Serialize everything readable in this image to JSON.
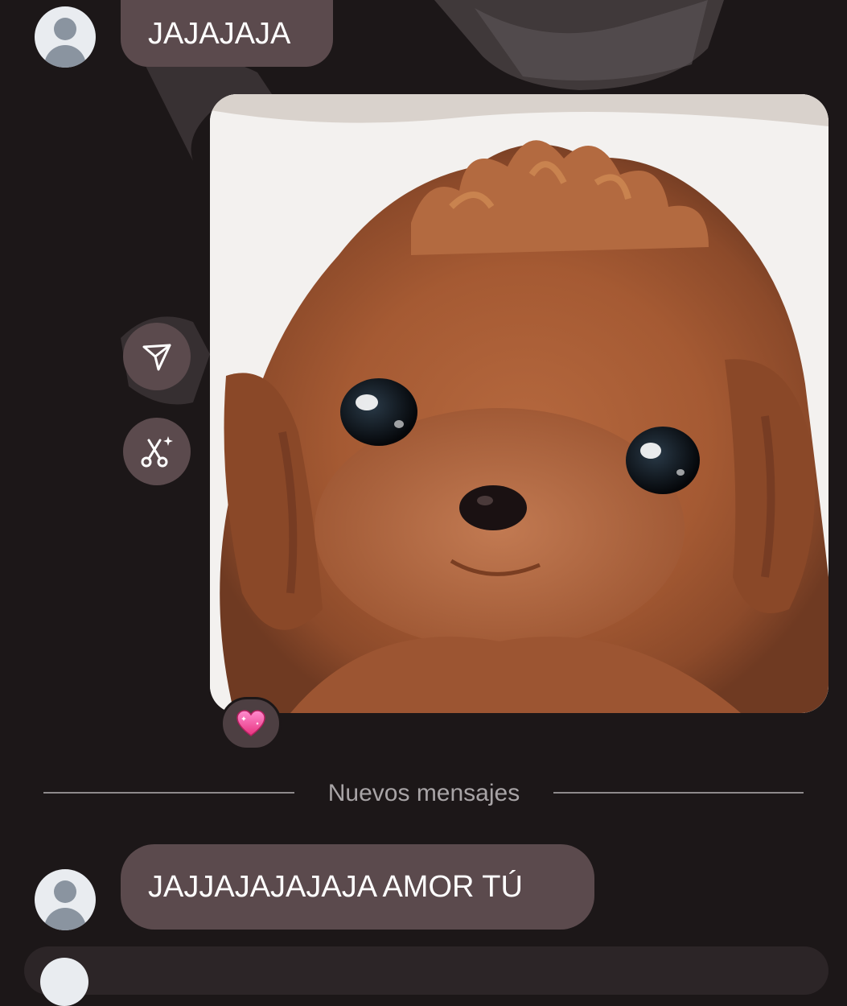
{
  "colors": {
    "background": "#1c1718",
    "bubble": "#5b4a4d",
    "divider": "#8e8a8c",
    "divider_text": "#a8a4a6"
  },
  "messages": [
    {
      "sender": "other",
      "text": "JAJAJAJA"
    },
    {
      "sender": "other",
      "type": "photo",
      "content": "puppy-photo",
      "reaction": "💗"
    },
    {
      "sender": "other",
      "text": "JAJJAJAJAJAJA AMOR TÚ"
    }
  ],
  "actions": {
    "share_icon": "send-icon",
    "remix_icon": "remix-sparkle-icon"
  },
  "divider": {
    "label": "Nuevos mensajes"
  }
}
